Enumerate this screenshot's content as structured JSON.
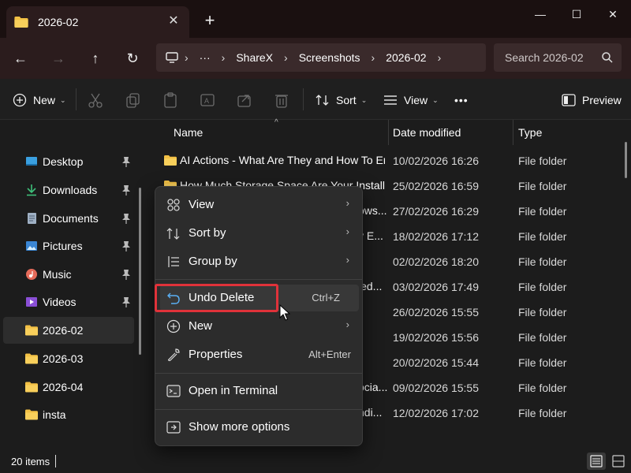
{
  "window": {
    "tab_title": "2026-02",
    "close_tab_glyph": "✕",
    "new_tab_glyph": "+",
    "minimize_glyph": "—",
    "maximize_glyph": "☐",
    "close_glyph": "✕"
  },
  "nav": {
    "back_glyph": "←",
    "forward_glyph": "→",
    "up_glyph": "↑",
    "refresh_glyph": "↻",
    "more_glyph": "···",
    "breadcrumb": [
      "ShareX",
      "Screenshots",
      "2026-02"
    ],
    "separator_glyph": "›"
  },
  "search": {
    "placeholder": "Search 2026-02"
  },
  "commandbar": {
    "new_label": "New",
    "sort_label": "Sort",
    "view_label": "View",
    "more_glyph": "•••",
    "preview_label": "Preview",
    "chevron_glyph": "⌄"
  },
  "sidebar": {
    "items": [
      {
        "label": "Desktop",
        "icon": "desktop-icon",
        "pinned": true
      },
      {
        "label": "Downloads",
        "icon": "downloads-icon",
        "pinned": true
      },
      {
        "label": "Documents",
        "icon": "documents-icon",
        "pinned": true
      },
      {
        "label": "Pictures",
        "icon": "pictures-icon",
        "pinned": true
      },
      {
        "label": "Music",
        "icon": "music-icon",
        "pinned": true
      },
      {
        "label": "Videos",
        "icon": "videos-icon",
        "pinned": true
      },
      {
        "label": "2026-02",
        "icon": "folder-icon",
        "pinned": false,
        "selected": true
      },
      {
        "label": "2026-03",
        "icon": "folder-icon",
        "pinned": false
      },
      {
        "label": "2026-04",
        "icon": "folder-icon",
        "pinned": false
      },
      {
        "label": "insta",
        "icon": "folder-icon",
        "pinned": false
      }
    ]
  },
  "filelist": {
    "columns": [
      "Name",
      "Date modified",
      "Type"
    ],
    "sort_caret_glyph": "^",
    "rows": [
      {
        "name": "AI Actions - What Are They and How To Enable...",
        "date": "10/02/2026 16:26",
        "type": "File folder"
      },
      {
        "name": "How Much Storage Space Are Your Installed Ap...",
        "date": "25/02/2026 16:59",
        "type": "File folder"
      },
      {
        "name": "ows...",
        "date": "27/02/2026 16:29",
        "type": "File folder"
      },
      {
        "name": "y E...",
        "date": "18/02/2026 17:12",
        "type": "File folder"
      },
      {
        "name": "",
        "date": "02/02/2026 18:20",
        "type": "File folder"
      },
      {
        "name": "led...",
        "date": "03/02/2026 17:49",
        "type": "File folder"
      },
      {
        "name": "",
        "date": "26/02/2026 15:55",
        "type": "File folder"
      },
      {
        "name": "",
        "date": "19/02/2026 15:56",
        "type": "File folder"
      },
      {
        "name": "",
        "date": "20/02/2026 15:44",
        "type": "File folder"
      },
      {
        "name": "ocia...",
        "date": "09/02/2026 15:55",
        "type": "File folder"
      },
      {
        "name": "ndi...",
        "date": "12/02/2026 17:02",
        "type": "File folder"
      }
    ]
  },
  "context_menu": {
    "view": "View",
    "sort_by": "Sort by",
    "group_by": "Group by",
    "undo_delete": "Undo Delete",
    "undo_shortcut": "Ctrl+Z",
    "new": "New",
    "properties": "Properties",
    "properties_shortcut": "Alt+Enter",
    "open_terminal": "Open in Terminal",
    "show_more": "Show more options",
    "submenu_glyph": "›"
  },
  "status": {
    "item_count": "20 items"
  },
  "colors": {
    "folder": "#f2c045",
    "highlight_border": "#e0323a",
    "menu_bg": "#2c2c2c"
  }
}
